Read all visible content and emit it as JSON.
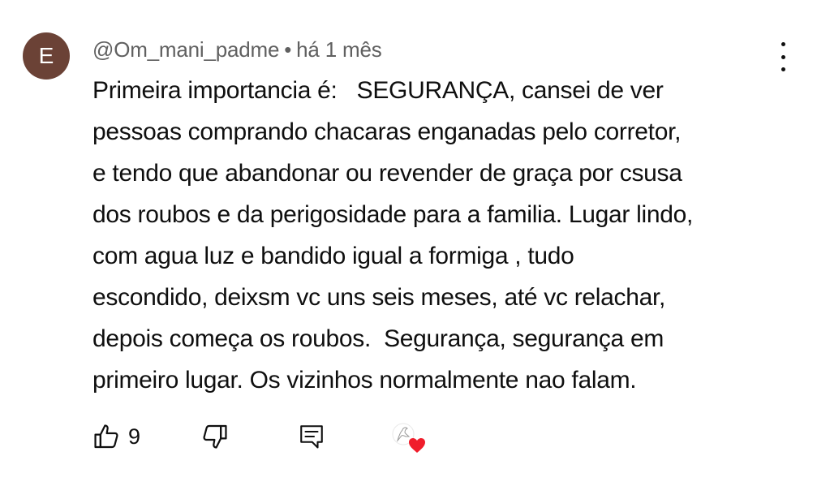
{
  "comment": {
    "avatar_letter": "E",
    "avatar_color": "#6b4236",
    "author": "@Om_mani_padme",
    "separator": "•",
    "time": "há 1 mês",
    "text": "Primeira importancia é:   SEGURANÇA, cansei de ver\npessoas comprando chacaras enganadas pelo corretor,\ne tendo que abandonar ou revender de graça por csusa\ndos roubos e da perigosidade para a familia. Lugar lindo,\ncom agua luz e bandido igual a formiga , tudo\nescondido, deixsm vc uns seis meses, até vc relachar,\ndepois começa os roubos.  Segurança, segurança em\nprimeiro lugar. Os vizinhos normalmente nao falam.",
    "like_count": "9"
  },
  "icons": {
    "menu": "more-vert-icon",
    "like": "thumbs-up-icon",
    "dislike": "thumbs-down-icon",
    "reply": "comment-reply-icon",
    "creator_heart": "creator-heart-icon"
  },
  "colors": {
    "heart": "#f01d2b",
    "meta_text": "#606060",
    "text": "#0f0f0f"
  }
}
